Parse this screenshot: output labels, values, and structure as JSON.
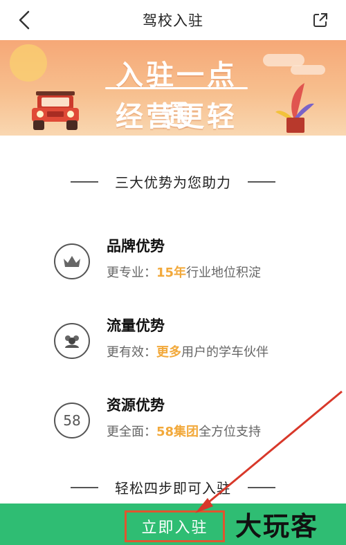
{
  "nav": {
    "title": "驾校入驻",
    "back_icon": "chevron-left-icon",
    "share_icon": "external-share-icon"
  },
  "banner": {
    "line1": "入驻一点通",
    "line2": "经营更轻松",
    "colors": {
      "top": "#f6a877",
      "bottom": "#f9d7b1",
      "text": "#ffffff"
    }
  },
  "advantages": {
    "heading": "三大优势为您助力",
    "items": [
      {
        "icon": "crown-icon",
        "title": "品牌优势",
        "desc_prefix": "更专业：",
        "desc_highlight": "15年",
        "desc_suffix": "行业地位积淀"
      },
      {
        "icon": "users-icon",
        "title": "流量优势",
        "desc_prefix": "更有效：",
        "desc_highlight": "更多",
        "desc_suffix": "用户的学车伙伴"
      },
      {
        "icon": "58-icon",
        "icon_text": "58",
        "title": "资源优势",
        "desc_prefix": "更全面：",
        "desc_highlight": "58集团",
        "desc_suffix": "全方位支持"
      }
    ]
  },
  "steps": {
    "heading": "轻松四步即可入驻"
  },
  "bottom": {
    "join_label": "立即入驻",
    "watermark": "大玩客"
  },
  "colors": {
    "accent_green": "#2fbd73",
    "highlight": "#f2a93b",
    "annotation_red": "#e0552e"
  }
}
